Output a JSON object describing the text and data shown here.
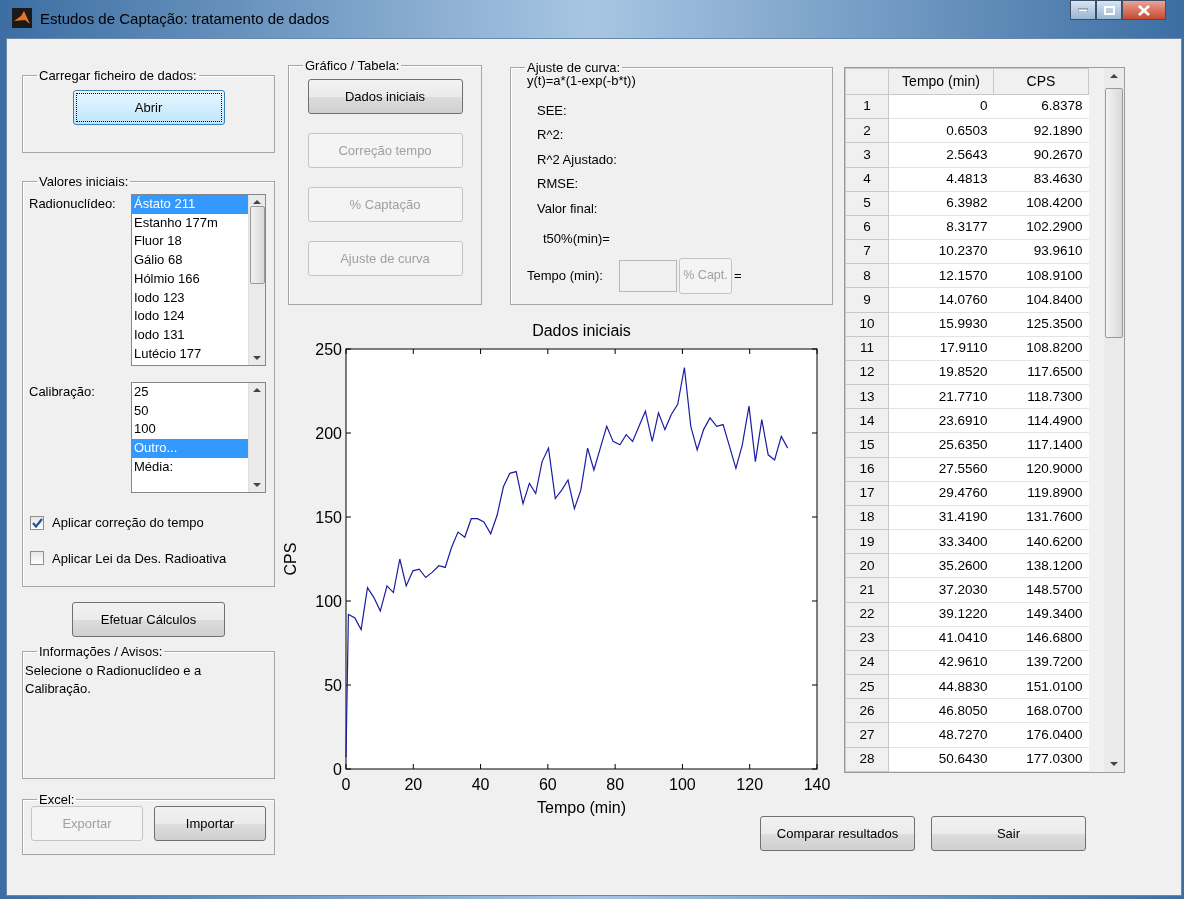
{
  "window": {
    "title": "Estudos de Captação: tratamento de dados"
  },
  "load_panel": {
    "title": "Carregar ficheiro de dados:",
    "buttons": [
      {
        "label": "Abrir",
        "disabled": false,
        "focused": true
      }
    ]
  },
  "initial_values_panel": {
    "title": "Valores iniciais:",
    "radionuclide": {
      "label": "Radionuclídeo:",
      "items": [
        {
          "label": "Ástato 211",
          "selected": true
        },
        {
          "label": "Estanho 177m",
          "selected": false
        },
        {
          "label": "Fluor 18",
          "selected": false
        },
        {
          "label": "Gálio 68",
          "selected": false
        },
        {
          "label": "Hólmio 166",
          "selected": false
        },
        {
          "label": "Iodo 123",
          "selected": false
        },
        {
          "label": "Iodo 124",
          "selected": false
        },
        {
          "label": "Iodo 131",
          "selected": false
        },
        {
          "label": "Lutécio 177",
          "selected": false
        }
      ]
    },
    "calibration": {
      "label": "Calibração:",
      "items": [
        {
          "label": "25",
          "selected": false
        },
        {
          "label": "50",
          "selected": false
        },
        {
          "label": "100",
          "selected": false
        },
        {
          "label": "Outro...",
          "selected": true
        },
        {
          "label": "Média:",
          "selected": false
        }
      ]
    },
    "checkboxes": [
      {
        "label": "Aplicar correção do tempo",
        "checked": true
      },
      {
        "label": "Aplicar Lei da Des. Radioativa",
        "checked": false
      }
    ]
  },
  "calculate_button": {
    "label": "Efetuar Cálculos",
    "disabled": false
  },
  "info_panel": {
    "title": "Informações / Avisos:",
    "message": "Selecione o Radionuclídeo e a Calibração."
  },
  "excel_panel": {
    "title": "Excel:",
    "buttons": [
      {
        "label": "Exportar",
        "disabled": true
      },
      {
        "label": "Importar",
        "disabled": false
      }
    ]
  },
  "graph_panel": {
    "title": "Gráfico / Tabela:",
    "buttons": [
      {
        "label": "Dados iniciais",
        "disabled": false
      },
      {
        "label": "Correção tempo",
        "disabled": true
      },
      {
        "label": "% Captação",
        "disabled": true
      },
      {
        "label": "Ajuste de curva",
        "disabled": true
      }
    ]
  },
  "fit_panel": {
    "title": "Ajuste de curva:",
    "formula": "y(t)=a*(1-exp(-b*t))",
    "stats": [
      "SEE:",
      "R^2:",
      "R^2 Ajustado:",
      "RMSE:",
      "Valor final:"
    ],
    "t50": "t50%(min)=",
    "time_label": "Tempo (min):",
    "capt_button": {
      "label": "% Capt.",
      "disabled": true
    },
    "equals": "="
  },
  "chart": {
    "chart_data": {
      "type": "line",
      "title": "Dados iniciais",
      "xlabel": "Tempo (min)",
      "ylabel": "CPS",
      "x": [
        0,
        0.7,
        2.6,
        4.5,
        6.4,
        8.3,
        10.2,
        12.2,
        14.1,
        16,
        17.9,
        19.9,
        21.8,
        23.7,
        25.6,
        27.6,
        29.5,
        31.4,
        33.3,
        35.3,
        37.2,
        39.1,
        41,
        43,
        44.9,
        46.8,
        48.7,
        50.6,
        52.6,
        54.5,
        56.4,
        58.3,
        60.2,
        62.2,
        64.1,
        66,
        67.9,
        69.8,
        71.8,
        73.7,
        75.6,
        77.5,
        79.4,
        81.4,
        83.3,
        85.2,
        87.1,
        89,
        91,
        92.9,
        94.8,
        96.7,
        98.6,
        100.6,
        102.5,
        104.4,
        106.3,
        108.2,
        110.2,
        112.1,
        114,
        115.9,
        117.8,
        119.8,
        121.7,
        123.6,
        125.5,
        127.4,
        129.4,
        131.3
      ],
      "series": [
        {
          "color": "#1c1ca0",
          "values": [
            7,
            92,
            90,
            83,
            108,
            102,
            94,
            109,
            105,
            125,
            109,
            118,
            119,
            114,
            117,
            121,
            120,
            132,
            141,
            138,
            149,
            149,
            147,
            140,
            151,
            168,
            176,
            177,
            158,
            170,
            164,
            183,
            191,
            161,
            166,
            172,
            155,
            166,
            191,
            178,
            191,
            204,
            195,
            193,
            199,
            195,
            204,
            213,
            195,
            212,
            202,
            211,
            217,
            239,
            204,
            190,
            202,
            209,
            204,
            205,
            192,
            179,
            193,
            216,
            183,
            208,
            187,
            184,
            198,
            191
          ]
        }
      ],
      "xlim": [
        0,
        140
      ],
      "ylim": [
        0,
        250
      ],
      "xticks": [
        0,
        20,
        40,
        60,
        80,
        100,
        120,
        140
      ],
      "yticks": [
        0,
        50,
        100,
        150,
        200,
        250
      ]
    }
  },
  "table": {
    "columns": [
      "Tempo (min)",
      "CPS"
    ],
    "rows": [
      {
        "index": "1",
        "cells": [
          "0",
          "6.8378"
        ]
      },
      {
        "index": "2",
        "cells": [
          "0.6503",
          "92.1890"
        ]
      },
      {
        "index": "3",
        "cells": [
          "2.5643",
          "90.2670"
        ]
      },
      {
        "index": "4",
        "cells": [
          "4.4813",
          "83.4630"
        ]
      },
      {
        "index": "5",
        "cells": [
          "6.3982",
          "108.4200"
        ]
      },
      {
        "index": "6",
        "cells": [
          "8.3177",
          "102.2900"
        ]
      },
      {
        "index": "7",
        "cells": [
          "10.2370",
          "93.9610"
        ]
      },
      {
        "index": "8",
        "cells": [
          "12.1570",
          "108.9100"
        ]
      },
      {
        "index": "9",
        "cells": [
          "14.0760",
          "104.8400"
        ]
      },
      {
        "index": "10",
        "cells": [
          "15.9930",
          "125.3500"
        ]
      },
      {
        "index": "11",
        "cells": [
          "17.9110",
          "108.8200"
        ]
      },
      {
        "index": "12",
        "cells": [
          "19.8520",
          "117.6500"
        ]
      },
      {
        "index": "13",
        "cells": [
          "21.7710",
          "118.7300"
        ]
      },
      {
        "index": "14",
        "cells": [
          "23.6910",
          "114.4900"
        ]
      },
      {
        "index": "15",
        "cells": [
          "25.6350",
          "117.1400"
        ]
      },
      {
        "index": "16",
        "cells": [
          "27.5560",
          "120.9000"
        ]
      },
      {
        "index": "17",
        "cells": [
          "29.4760",
          "119.8900"
        ]
      },
      {
        "index": "18",
        "cells": [
          "31.4190",
          "131.7600"
        ]
      },
      {
        "index": "19",
        "cells": [
          "33.3400",
          "140.6200"
        ]
      },
      {
        "index": "20",
        "cells": [
          "35.2600",
          "138.1200"
        ]
      },
      {
        "index": "21",
        "cells": [
          "37.2030",
          "148.5700"
        ]
      },
      {
        "index": "22",
        "cells": [
          "39.1220",
          "149.3400"
        ]
      },
      {
        "index": "23",
        "cells": [
          "41.0410",
          "146.6800"
        ]
      },
      {
        "index": "24",
        "cells": [
          "42.9610",
          "139.7200"
        ]
      },
      {
        "index": "25",
        "cells": [
          "44.8830",
          "151.0100"
        ]
      },
      {
        "index": "26",
        "cells": [
          "46.8050",
          "168.0700"
        ]
      },
      {
        "index": "27",
        "cells": [
          "48.7270",
          "176.0400"
        ]
      },
      {
        "index": "28",
        "cells": [
          "50.6430",
          "177.0300"
        ]
      }
    ]
  },
  "footer_buttons": [
    {
      "label": "Comparar resultados",
      "disabled": false
    },
    {
      "label": "Sair",
      "disabled": false
    }
  ]
}
